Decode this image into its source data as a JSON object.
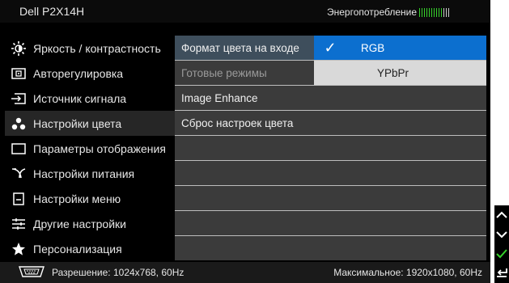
{
  "header": {
    "title": "Dell P2X14H",
    "power_label": "Энергопотребление",
    "power_bars_on": 10,
    "power_bars_total": 13
  },
  "left_menu": [
    {
      "label": "Яркость / контрастность",
      "icon": "brightness-icon"
    },
    {
      "label": "Авторегулировка",
      "icon": "auto-adjust-icon"
    },
    {
      "label": "Источник сигнала",
      "icon": "input-source-icon"
    },
    {
      "label": "Настройки цвета",
      "icon": "color-settings-icon"
    },
    {
      "label": "Параметры отображения",
      "icon": "display-settings-icon"
    },
    {
      "label": "Настройки питания",
      "icon": "power-settings-icon"
    },
    {
      "label": "Настройки меню",
      "icon": "menu-settings-icon"
    },
    {
      "label": "Другие настройки",
      "icon": "other-settings-icon"
    },
    {
      "label": "Персонализация",
      "icon": "star-icon"
    }
  ],
  "mid_menu": [
    {
      "label": "Формат цвета на входе",
      "state": "selected"
    },
    {
      "label": "Готовые режимы",
      "state": "dim"
    },
    {
      "label": "Image Enhance",
      "state": "normal"
    },
    {
      "label": "Сброс настроек цвета",
      "state": "normal"
    }
  ],
  "options": [
    {
      "label": "RGB",
      "checked": true,
      "check_glyph": "✓"
    },
    {
      "label": "YPbPr",
      "checked": false
    }
  ],
  "footer": {
    "resolution": "Разрешение: 1024x768, 60Hz",
    "max": "Максимальное: 1920x1080, 60Hz"
  },
  "side_buttons": [
    "up-icon",
    "down-icon",
    "check-icon",
    "back-icon"
  ],
  "colors": {
    "highlight": "#0c6fcf",
    "power_bar_on": "#36d12a",
    "power_bar_off": "#cfcfcf",
    "check_green": "#36d12a"
  }
}
